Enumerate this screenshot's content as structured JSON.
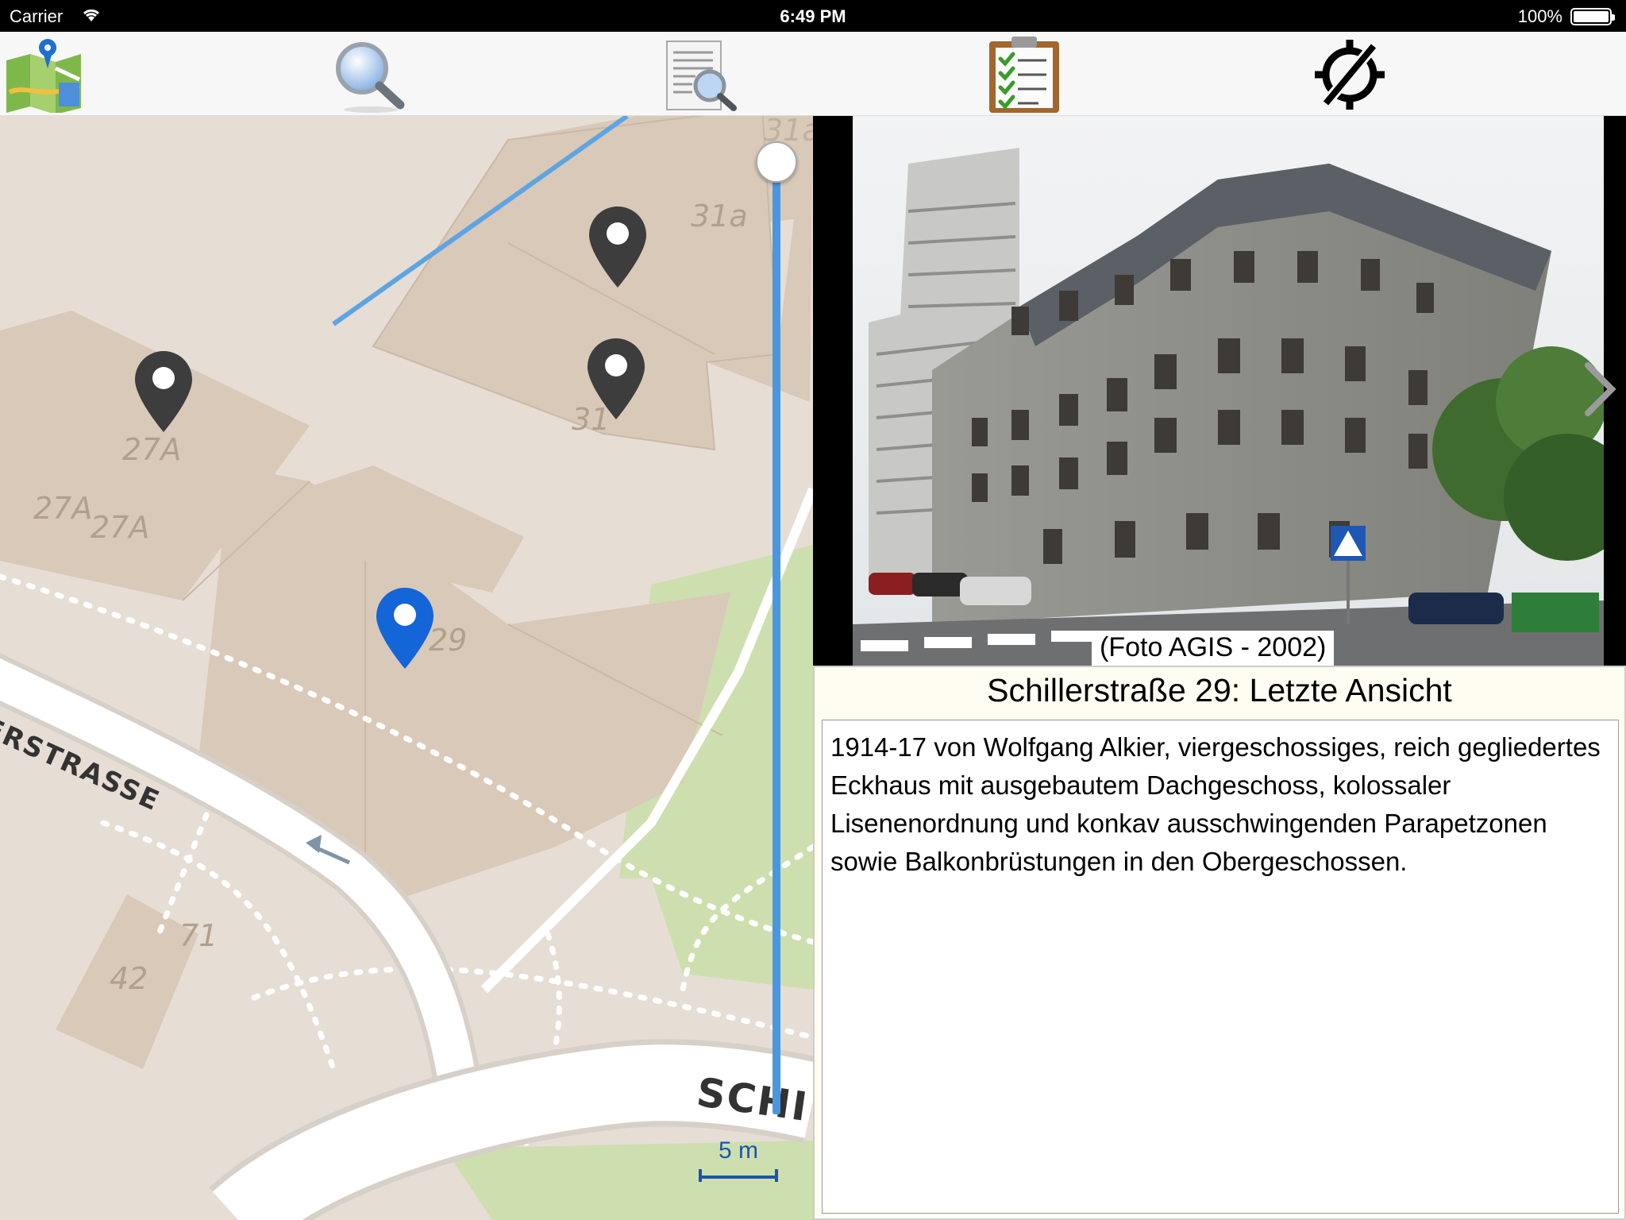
{
  "status_bar": {
    "carrier": "Carrier",
    "time": "6:49 PM",
    "battery": "100%"
  },
  "toolbar": {
    "items": [
      {
        "name": "map",
        "icon": "map-icon"
      },
      {
        "name": "search",
        "icon": "search-icon"
      },
      {
        "name": "document-search",
        "icon": "document-search-icon"
      },
      {
        "name": "checklist",
        "icon": "clipboard-checklist-icon"
      },
      {
        "name": "location-off",
        "icon": "location-disabled-icon"
      }
    ]
  },
  "map": {
    "building_labels": [
      "31a",
      "31",
      "27A",
      "27A",
      "27A",
      "29",
      "71",
      "42",
      "31a"
    ],
    "street_labels": [
      "ERSTRASSE",
      "SCHI"
    ],
    "scale_label": "5 m",
    "colors": {
      "land": "#e6ddd5",
      "building": "#d9c9b8",
      "park": "#cddfae",
      "pin_default": "#3d3d3d",
      "pin_selected": "#1365d8",
      "waterway": "#5ea4e3"
    }
  },
  "photo": {
    "caption": "(Foto AGIS - 2002)"
  },
  "info": {
    "title": "Schillerstraße 29: Letzte Ansicht",
    "description": "1914-17 von Wolfgang Alkier, viergeschossiges, reich gegliedertes Eckhaus mit ausgebautem Dachgeschoss, kolossaler Lisenenordnung und konkav ausschwingenden Parapetzonen sowie Balkonbrüstungen in den Obergeschossen."
  }
}
